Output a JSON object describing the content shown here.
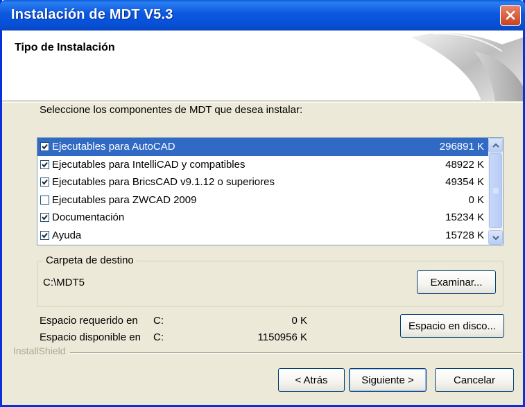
{
  "window": {
    "title": "Instalación de MDT V5.3"
  },
  "header": {
    "title": "Tipo de Instalación"
  },
  "prompt": "Seleccione los componentes de MDT que desea instalar:",
  "components": [
    {
      "label": "Ejecutables para AutoCAD",
      "size": "296891 K",
      "checked": true,
      "selected": true
    },
    {
      "label": "Ejecutables para IntelliCAD y compatibles",
      "size": "48922 K",
      "checked": true,
      "selected": false
    },
    {
      "label": "Ejecutables para BricsCAD v9.1.12 o superiores",
      "size": "49354 K",
      "checked": true,
      "selected": false
    },
    {
      "label": "Ejecutables para ZWCAD 2009",
      "size": "0 K",
      "checked": false,
      "selected": false
    },
    {
      "label": "Documentación",
      "size": "15234 K",
      "checked": true,
      "selected": false
    },
    {
      "label": "Ayuda",
      "size": "15728 K",
      "checked": true,
      "selected": false
    }
  ],
  "destination": {
    "legend": "Carpeta de destino",
    "path": "C:\\MDT5",
    "browse_label": "Examinar..."
  },
  "space": {
    "required_label": "Espacio requerido en",
    "required_drive": "C:",
    "required_value": "0 K",
    "available_label": "Espacio disponible en",
    "available_drive": "C:",
    "available_value": "1150956 K",
    "disk_button_label": "Espacio en disco..."
  },
  "brand": "InstallShield",
  "nav": {
    "back_label": "< Atrás",
    "next_label": "Siguiente >",
    "cancel_label": "Cancelar"
  }
}
